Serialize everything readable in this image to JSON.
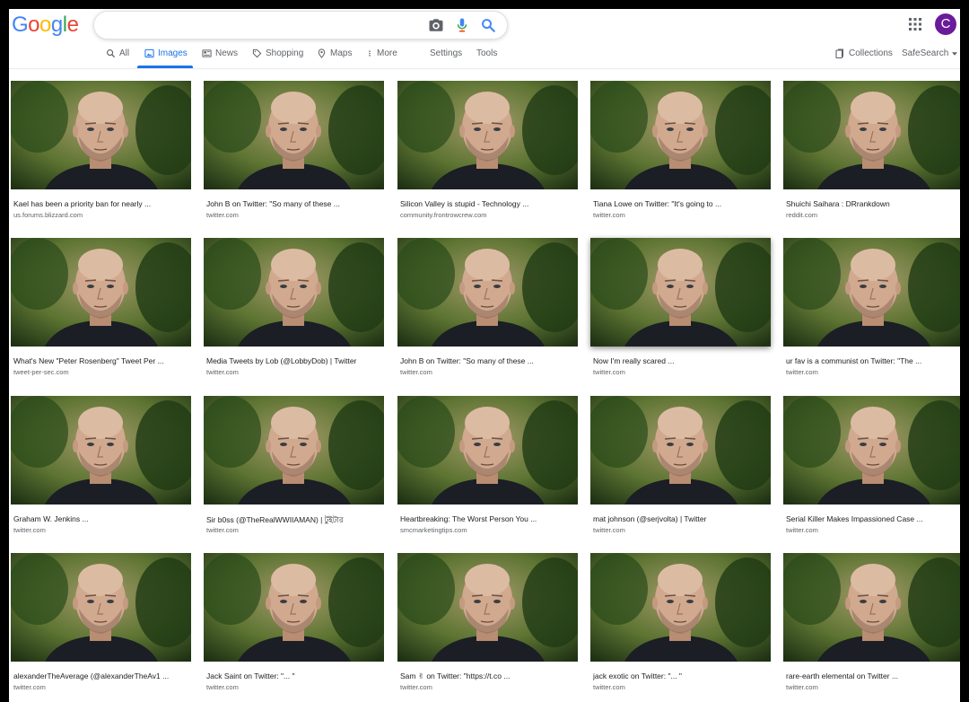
{
  "header": {
    "logo_letters": [
      {
        "ch": "G",
        "color": "#4285F4"
      },
      {
        "ch": "o",
        "color": "#EA4335"
      },
      {
        "ch": "o",
        "color": "#FBBC05"
      },
      {
        "ch": "g",
        "color": "#4285F4"
      },
      {
        "ch": "l",
        "color": "#34A853"
      },
      {
        "ch": "e",
        "color": "#EA4335"
      }
    ],
    "search_value": "",
    "avatar_letter": "C"
  },
  "nav": {
    "all": "All",
    "images": "Images",
    "news": "News",
    "shopping": "Shopping",
    "maps": "Maps",
    "more": "More",
    "settings": "Settings",
    "tools": "Tools",
    "collections": "Collections",
    "safesearch": "SafeSearch"
  },
  "results": [
    {
      "caption": "Kael has been a priority ban for nearly ...",
      "source": "us.forums.blizzard.com"
    },
    {
      "caption": "John B on Twitter: \"So many of these ...",
      "source": "twitter.com"
    },
    {
      "caption": "Silicon Valley is stupid - Technology ...",
      "source": "community.frontrowcrew.com"
    },
    {
      "caption": "Tiana Lowe on Twitter: \"It's going to ...",
      "source": "twitter.com"
    },
    {
      "caption": "Shuichi Saihara : DRrankdown",
      "source": "reddit.com"
    },
    {
      "caption": "What's New \"Peter Rosenberg\" Tweet Per ...",
      "source": "tweet-per-sec.com"
    },
    {
      "caption": "Media Tweets by Lob (@LobbyDob) | Twitter",
      "source": "twitter.com"
    },
    {
      "caption": "John B on Twitter: \"So many of these ...",
      "source": "twitter.com"
    },
    {
      "caption": "Now I'm really scared ...",
      "source": "twitter.com"
    },
    {
      "caption": "ur fav is a communist on Twitter: \"The ...",
      "source": "twitter.com"
    },
    {
      "caption": "Graham W. Jenkins ...",
      "source": "twitter.com"
    },
    {
      "caption": "Sir b0ss (@TheRealWWIIAMAN) | টুইটার",
      "source": "twitter.com"
    },
    {
      "caption": "Heartbreaking: The Worst Person You ...",
      "source": "smcmarketingtips.com"
    },
    {
      "caption": "mat johnson (@serjvolta) | Twitter",
      "source": "twitter.com"
    },
    {
      "caption": "Serial Killer Makes Impassioned Case ...",
      "source": "twitter.com"
    },
    {
      "caption": "alexanderTheAverage (@alexanderTheAv1 ...",
      "source": "twitter.com"
    },
    {
      "caption": "Jack Saint on Twitter: \"... \"",
      "source": "twitter.com"
    },
    {
      "caption": "Sam ✌ on Twitter: \"https://t.co ...",
      "source": "twitter.com"
    },
    {
      "caption": "jack exotic on Twitter: \"... \"",
      "source": "twitter.com"
    },
    {
      "caption": "rare-earth elemental on Twitter ...",
      "source": "twitter.com"
    }
  ],
  "colors": {
    "accent": "#1a73e8",
    "avatar": "#6a1b9a"
  }
}
